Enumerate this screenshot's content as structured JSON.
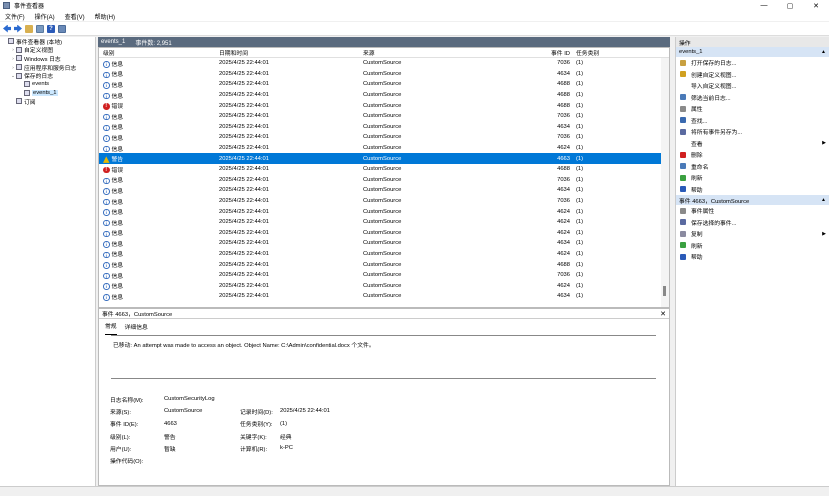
{
  "window": {
    "title": "事件查看器",
    "minimize": "—",
    "maximize": "▢",
    "close": "✕"
  },
  "menu": [
    "文件(F)",
    "操作(A)",
    "查看(V)",
    "帮助(H)"
  ],
  "tree": [
    {
      "label": "事件查看器 (本地)",
      "indent": 0,
      "arrow": ""
    },
    {
      "label": "自定义视图",
      "indent": 1,
      "arrow": "›"
    },
    {
      "label": "Windows 日志",
      "indent": 1,
      "arrow": "›"
    },
    {
      "label": "应用程序和服务日志",
      "indent": 1,
      "arrow": "›"
    },
    {
      "label": "保存的日志",
      "indent": 1,
      "arrow": "⌄"
    },
    {
      "label": "events",
      "indent": 2,
      "arrow": ""
    },
    {
      "label": "events_1",
      "indent": 2,
      "arrow": "",
      "selected": true
    },
    {
      "label": "订阅",
      "indent": 1,
      "arrow": ""
    }
  ],
  "log": {
    "name": "events_1",
    "count_label": "事件数: 2,951"
  },
  "columns": {
    "level": "级别",
    "date": "日期和时间",
    "source": "来源",
    "id": "事件 ID",
    "task": "任务类别"
  },
  "events": [
    {
      "level": "信息",
      "type": "info",
      "date": "2025/4/25 22:44:01",
      "source": "CustomSource",
      "id": "7036",
      "task": "(1)"
    },
    {
      "level": "信息",
      "type": "info",
      "date": "2025/4/25 22:44:01",
      "source": "CustomSource",
      "id": "4634",
      "task": "(1)"
    },
    {
      "level": "信息",
      "type": "info",
      "date": "2025/4/25 22:44:01",
      "source": "CustomSource",
      "id": "4688",
      "task": "(1)"
    },
    {
      "level": "信息",
      "type": "info",
      "date": "2025/4/25 22:44:01",
      "source": "CustomSource",
      "id": "4688",
      "task": "(1)"
    },
    {
      "level": "错误",
      "type": "error",
      "date": "2025/4/25 22:44:01",
      "source": "CustomSource",
      "id": "4688",
      "task": "(1)"
    },
    {
      "level": "信息",
      "type": "info",
      "date": "2025/4/25 22:44:01",
      "source": "CustomSource",
      "id": "7036",
      "task": "(1)"
    },
    {
      "level": "信息",
      "type": "info",
      "date": "2025/4/25 22:44:01",
      "source": "CustomSource",
      "id": "4634",
      "task": "(1)"
    },
    {
      "level": "信息",
      "type": "info",
      "date": "2025/4/25 22:44:01",
      "source": "CustomSource",
      "id": "7036",
      "task": "(1)"
    },
    {
      "level": "信息",
      "type": "info",
      "date": "2025/4/25 22:44:01",
      "source": "CustomSource",
      "id": "4624",
      "task": "(1)"
    },
    {
      "level": "警告",
      "type": "warn",
      "date": "2025/4/25 22:44:01",
      "source": "CustomSource",
      "id": "4663",
      "task": "(1)",
      "selected": true
    },
    {
      "level": "错误",
      "type": "error",
      "date": "2025/4/25 22:44:01",
      "source": "CustomSource",
      "id": "4688",
      "task": "(1)"
    },
    {
      "level": "信息",
      "type": "info",
      "date": "2025/4/25 22:44:01",
      "source": "CustomSource",
      "id": "7036",
      "task": "(1)"
    },
    {
      "level": "信息",
      "type": "info",
      "date": "2025/4/25 22:44:01",
      "source": "CustomSource",
      "id": "4634",
      "task": "(1)"
    },
    {
      "level": "信息",
      "type": "info",
      "date": "2025/4/25 22:44:01",
      "source": "CustomSource",
      "id": "7036",
      "task": "(1)"
    },
    {
      "level": "信息",
      "type": "info",
      "date": "2025/4/25 22:44:01",
      "source": "CustomSource",
      "id": "4624",
      "task": "(1)"
    },
    {
      "level": "信息",
      "type": "info",
      "date": "2025/4/25 22:44:01",
      "source": "CustomSource",
      "id": "4624",
      "task": "(1)"
    },
    {
      "level": "信息",
      "type": "info",
      "date": "2025/4/25 22:44:01",
      "source": "CustomSource",
      "id": "4624",
      "task": "(1)"
    },
    {
      "level": "信息",
      "type": "info",
      "date": "2025/4/25 22:44:01",
      "source": "CustomSource",
      "id": "4634",
      "task": "(1)"
    },
    {
      "level": "信息",
      "type": "info",
      "date": "2025/4/25 22:44:01",
      "source": "CustomSource",
      "id": "4624",
      "task": "(1)"
    },
    {
      "level": "信息",
      "type": "info",
      "date": "2025/4/25 22:44:01",
      "source": "CustomSource",
      "id": "4688",
      "task": "(1)"
    },
    {
      "level": "信息",
      "type": "info",
      "date": "2025/4/25 22:44:01",
      "source": "CustomSource",
      "id": "7036",
      "task": "(1)"
    },
    {
      "level": "信息",
      "type": "info",
      "date": "2025/4/25 22:44:01",
      "source": "CustomSource",
      "id": "4624",
      "task": "(1)"
    },
    {
      "level": "信息",
      "type": "info",
      "date": "2025/4/25 22:44:01",
      "source": "CustomSource",
      "id": "4634",
      "task": "(1)"
    }
  ],
  "detail": {
    "header": "事件 4663，CustomSource",
    "close": "✕",
    "tabs": [
      "常规",
      "详细信息"
    ],
    "message": "已移动: An attempt was made to access an object. Object Name: C:\\Admin\\confidential.docx 个文件。",
    "log_name_label": "日志名称(M):",
    "log_name": "CustomSecurityLog",
    "source_label": "来源(S):",
    "source": "CustomSource",
    "logged_label": "记录时间(D):",
    "logged": "2025/4/25 22:44:01",
    "event_id_label": "事件 ID(E):",
    "event_id": "4663",
    "task_label": "任务类别(Y):",
    "task": "(1)",
    "level_label": "级别(L):",
    "level": "警告",
    "keywords_label": "关键字(K):",
    "keywords": "经典",
    "user_label": "用户(U):",
    "user": "暂缺",
    "computer_label": "计算机(R):",
    "computer": "k-PC",
    "opcode_label": "操作代码(O):",
    "opcode": ""
  },
  "actions": {
    "header": "操作",
    "group1": "events_1",
    "items1": [
      {
        "label": "打开保存的日志...",
        "color": "#c8a040"
      },
      {
        "label": "创建自定义视图...",
        "color": "#d0a020"
      },
      {
        "label": "导入自定义视图...",
        "color": ""
      },
      {
        "label": "筛选当前日志...",
        "color": "#4a7ab8"
      },
      {
        "label": "属性",
        "color": "#8a8a8a"
      },
      {
        "label": "查找...",
        "color": "#3a6ab0"
      },
      {
        "label": "将所有事件另存为...",
        "color": "#5a6aa0"
      },
      {
        "label": "查看",
        "color": "",
        "submenu": true
      },
      {
        "label": "删除",
        "color": "#d02020"
      },
      {
        "label": "重命名",
        "color": "#4a7ab8"
      },
      {
        "label": "刷新",
        "color": "#3aa040"
      },
      {
        "label": "帮助",
        "color": "#2a5ab8"
      }
    ],
    "group2": "事件 4663，CustomSource",
    "items2": [
      {
        "label": "事件属性",
        "color": "#8a8a8a"
      },
      {
        "label": "保存选择的事件...",
        "color": "#5a6aa0"
      },
      {
        "label": "复制",
        "color": "#8a8aa0",
        "submenu": true
      },
      {
        "label": "刷新",
        "color": "#3aa040"
      },
      {
        "label": "帮助",
        "color": "#2a5ab8"
      }
    ]
  }
}
